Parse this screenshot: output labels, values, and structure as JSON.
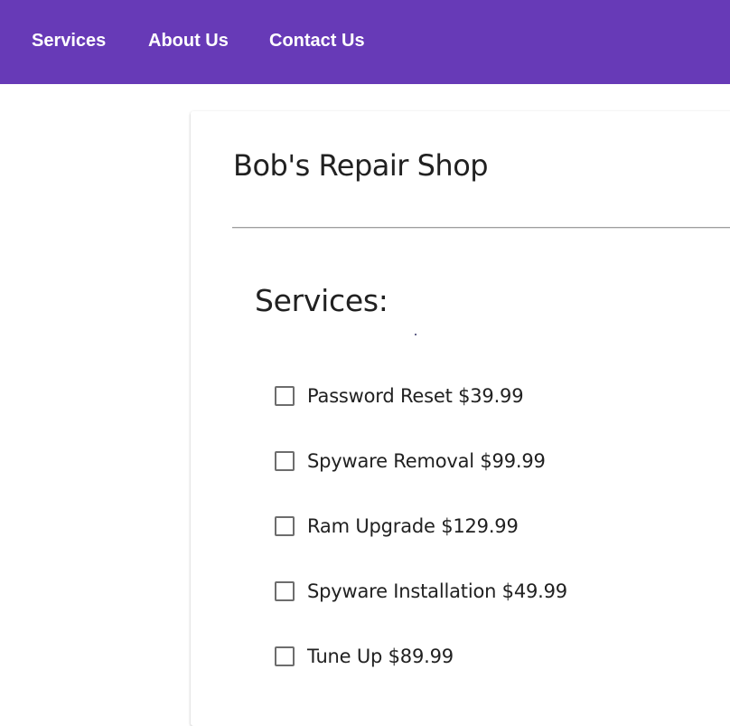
{
  "nav": {
    "services": "Services",
    "about": "About Us",
    "contact": "Contact Us"
  },
  "card": {
    "title": "Bob's Repair Shop",
    "services_heading": "Services:"
  },
  "services": [
    {
      "label": "Password Reset $39.99",
      "checked": false
    },
    {
      "label": "Spyware Removal $99.99",
      "checked": false
    },
    {
      "label": "Ram Upgrade $129.99",
      "checked": false
    },
    {
      "label": "Spyware Installation $49.99",
      "checked": false
    },
    {
      "label": "Tune Up $89.99",
      "checked": false
    }
  ],
  "colors": {
    "topbar": "#673ab7",
    "nav_text": "#ffffff",
    "text": "#212121",
    "checkbox_border": "#6d6d6d"
  }
}
